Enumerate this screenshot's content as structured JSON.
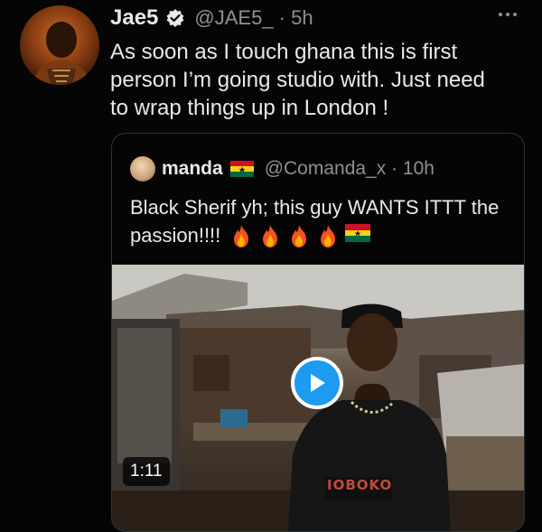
{
  "tweet": {
    "display_name": "Jae5",
    "handle_time": "@JAE5_ · 5h",
    "text": "As soon as I touch ghana this is first\nperson I’m going studio with. Just need\nto wrap things up in London !"
  },
  "quoted_tweet": {
    "name": "manda",
    "handle_time": "@Comanda_x · 10h",
    "text": "Black Sherif yh; this guy WANTS ITTT the passion!!!!",
    "emojis": [
      "fire-icon",
      "fire-icon",
      "fire-icon",
      "fire-icon",
      "ghana-flag-icon"
    ]
  },
  "video": {
    "duration": "1:11",
    "shirt_text": "IOBOKO"
  },
  "colors": {
    "background": "#050505",
    "text": "#e7e9ea",
    "muted": "#8b9197",
    "accent": "#1d9bf0",
    "border": "#2f3336"
  }
}
